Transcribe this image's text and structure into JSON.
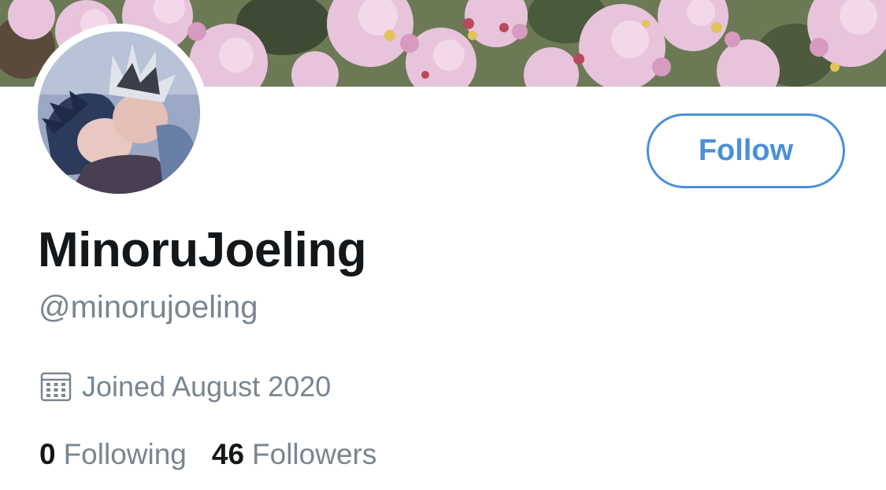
{
  "profile": {
    "display_name": "MinoruJoeling",
    "handle": "@minorujoeling",
    "joined": "Joined August 2020",
    "follow_label": "Follow"
  },
  "stats": {
    "following_count": "0",
    "following_label": "Following",
    "followers_count": "46",
    "followers_label": "Followers"
  },
  "colors": {
    "accent": "#4a90d9",
    "text_primary": "#14171a",
    "text_secondary": "#7a8590"
  },
  "icons": {
    "joined": "calendar-icon"
  }
}
